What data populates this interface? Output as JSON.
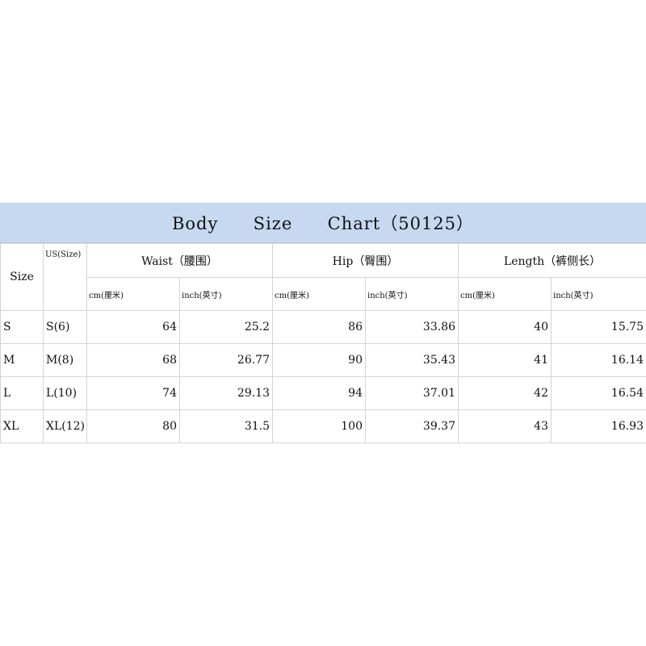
{
  "title": "Body  Size  Chart（50125）",
  "columns": {
    "size": "Size",
    "us_size": "US(Size)",
    "waist": "Waist（腰围）",
    "hip": "Hip（臀围）",
    "length": "Length（裤侧长）",
    "cm": "cm(厘米)",
    "inch": "inch(英寸)"
  },
  "rows": [
    {
      "size": "S",
      "us": "S(6)",
      "waist_cm": "64",
      "waist_in": "25.2",
      "hip_cm": "86",
      "hip_in": "33.86",
      "length_cm": "40",
      "length_in": "15.75"
    },
    {
      "size": "M",
      "us": "M(8)",
      "waist_cm": "68",
      "waist_in": "26.77",
      "hip_cm": "90",
      "hip_in": "35.43",
      "length_cm": "41",
      "length_in": "16.14"
    },
    {
      "size": "L",
      "us": "L(10)",
      "waist_cm": "74",
      "waist_in": "29.13",
      "hip_cm": "94",
      "hip_in": "37.01",
      "length_cm": "42",
      "length_in": "16.54"
    },
    {
      "size": "XL",
      "us": "XL(12)",
      "waist_cm": "80",
      "waist_in": "31.5",
      "hip_cm": "100",
      "hip_in": "39.37",
      "length_cm": "43",
      "length_in": "16.93"
    }
  ],
  "colors": {
    "title_background": "#c7d9f1",
    "grid_line": "#d4d4d4",
    "text": "#111111"
  }
}
